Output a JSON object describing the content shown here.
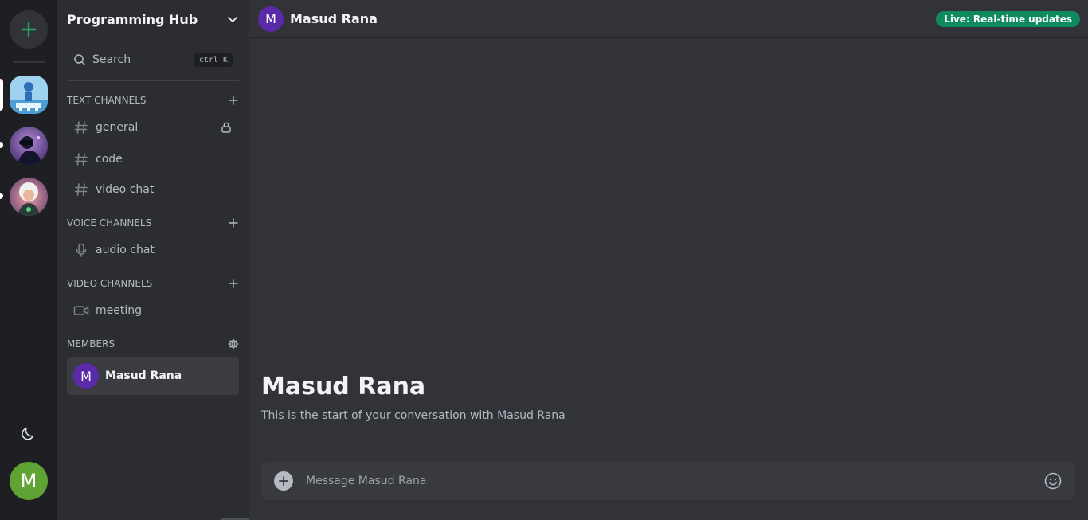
{
  "rail": {
    "add_server_label": "+",
    "servers": [
      {
        "name": "server-1",
        "selected": true
      },
      {
        "name": "server-2",
        "selected": false,
        "unread": true
      },
      {
        "name": "server-3",
        "selected": false,
        "unread": true
      }
    ],
    "user_initial": "M",
    "theme_icon": "moon-icon"
  },
  "sidebar": {
    "server_name": "Programming Hub",
    "search_label": "Search",
    "search_shortcut": "ctrl K",
    "text_section": "Text Channels",
    "text_channels": [
      {
        "name": "general",
        "locked": true
      },
      {
        "name": "code",
        "locked": false
      },
      {
        "name": "video chat",
        "locked": false
      }
    ],
    "voice_section": "Voice Channels",
    "voice_channels": [
      {
        "name": "audio chat"
      }
    ],
    "video_section": "Video Channels",
    "video_channels": [
      {
        "name": "meeting"
      }
    ],
    "members_section": "Members",
    "members": [
      {
        "initial": "M",
        "name": "Masud Rana"
      }
    ]
  },
  "chat": {
    "header_initial": "M",
    "header_name": "Masud Rana",
    "live_badge": "Live: Real-time updates",
    "welcome_title": "Masud Rana",
    "welcome_sub": "This is the start of your conversation with Masud Rana",
    "composer_placeholder": "Message Masud Rana"
  },
  "colors": {
    "accent_green": "#23a55a",
    "badge_green": "#0f8a5f",
    "avatar_purple": "#5b2aa8",
    "user_green": "#5fa334"
  }
}
